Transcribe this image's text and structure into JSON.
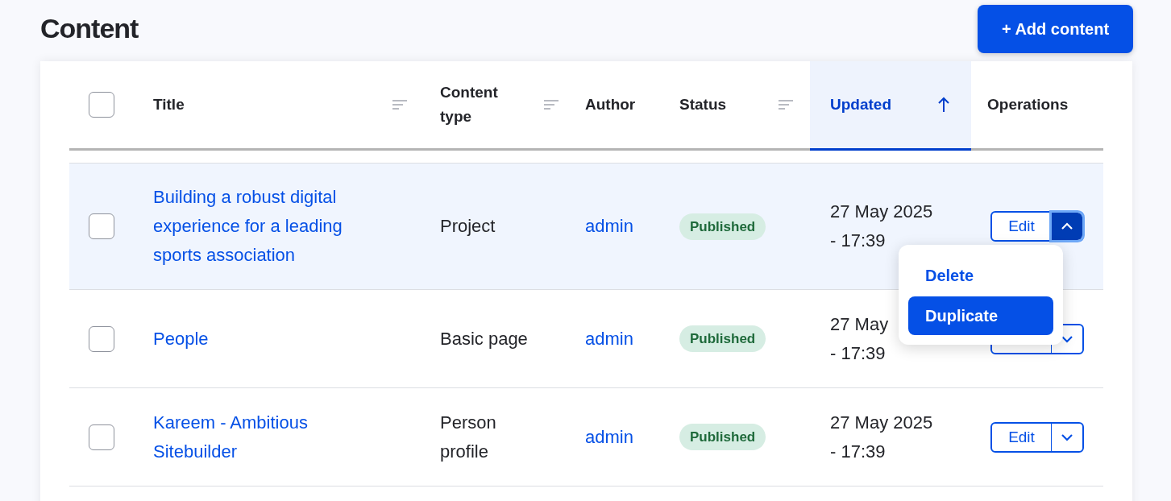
{
  "page": {
    "title": "Content",
    "add_button": "+ Add content"
  },
  "table": {
    "select_all": {
      "checked": false
    },
    "columns": [
      {
        "label": "Title",
        "sortable": true,
        "selected": false
      },
      {
        "label": "Content type",
        "sortable": true,
        "selected": false
      },
      {
        "label": "Author",
        "sortable": false,
        "selected": false
      },
      {
        "label": "Status",
        "sortable": true,
        "selected": false
      },
      {
        "label": "Updated",
        "sortable": true,
        "selected": true
      },
      {
        "label": "Operations",
        "sortable": false,
        "selected": false
      }
    ],
    "rows": [
      {
        "checked": false,
        "highlighted": true,
        "title": "Building a robust digital experience for a leading sports association",
        "content_type": "Project",
        "author": "admin",
        "status": "Published",
        "updated_date": "27 May 2025",
        "updated_time": "- 17:39",
        "edit": "Edit",
        "expanded": true
      },
      {
        "checked": false,
        "highlighted": false,
        "title": "People",
        "content_type": "Basic page",
        "author": "admin",
        "status": "Published",
        "updated_date": "27 May",
        "updated_time": "- 17:39",
        "expanded": false
      },
      {
        "checked": false,
        "highlighted": false,
        "title": "Kareem - Ambitious Sitebuilder",
        "content_type": "Person profile",
        "author": "admin",
        "status": "Published",
        "updated_date": "27 May 2025",
        "updated_time": "- 17:39",
        "edit": "Edit",
        "expanded": false
      }
    ]
  },
  "menu": {
    "items": [
      {
        "label": "Delete",
        "selected": false
      },
      {
        "label": "Duplicate",
        "selected": true
      }
    ]
  }
}
